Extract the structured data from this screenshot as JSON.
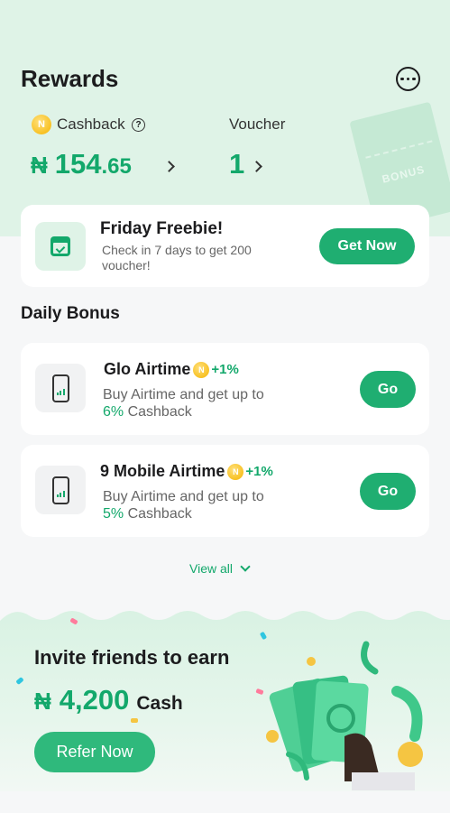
{
  "header": {
    "title": "Rewards",
    "more_icon": "more-dots-icon"
  },
  "cashback": {
    "label": "Cashback",
    "currency": "₦",
    "amount_int": "154",
    "amount_dec": ".65",
    "coin_symbol": "N"
  },
  "voucher": {
    "label": "Voucher",
    "count": "1"
  },
  "ticket": {
    "label": "BONUS"
  },
  "freebie": {
    "title": "Friday Freebie!",
    "subtitle": "Check in 7 days to get 200 voucher!",
    "button": "Get Now"
  },
  "daily_bonus": {
    "title": "Daily Bonus",
    "items": [
      {
        "name": "Glo Airtime",
        "bonus": "+1%",
        "desc": "Buy Airtime and get up to",
        "cashback_pct": "6%",
        "cashback_label": " Cashback",
        "button": "Go"
      },
      {
        "name": "9 Mobile Airtime",
        "bonus": "+1%",
        "desc": "Buy Airtime and get up to",
        "cashback_pct": "5%",
        "cashback_label": " Cashback",
        "button": "Go"
      }
    ],
    "view_all": "View all"
  },
  "invite": {
    "title": "Invite friends to earn",
    "currency": "₦",
    "amount": "4,200",
    "unit": "Cash",
    "button": "Refer Now"
  },
  "colors": {
    "accent": "#13a86b",
    "button": "#1fae71",
    "hero_bg": "#dff3e7"
  }
}
